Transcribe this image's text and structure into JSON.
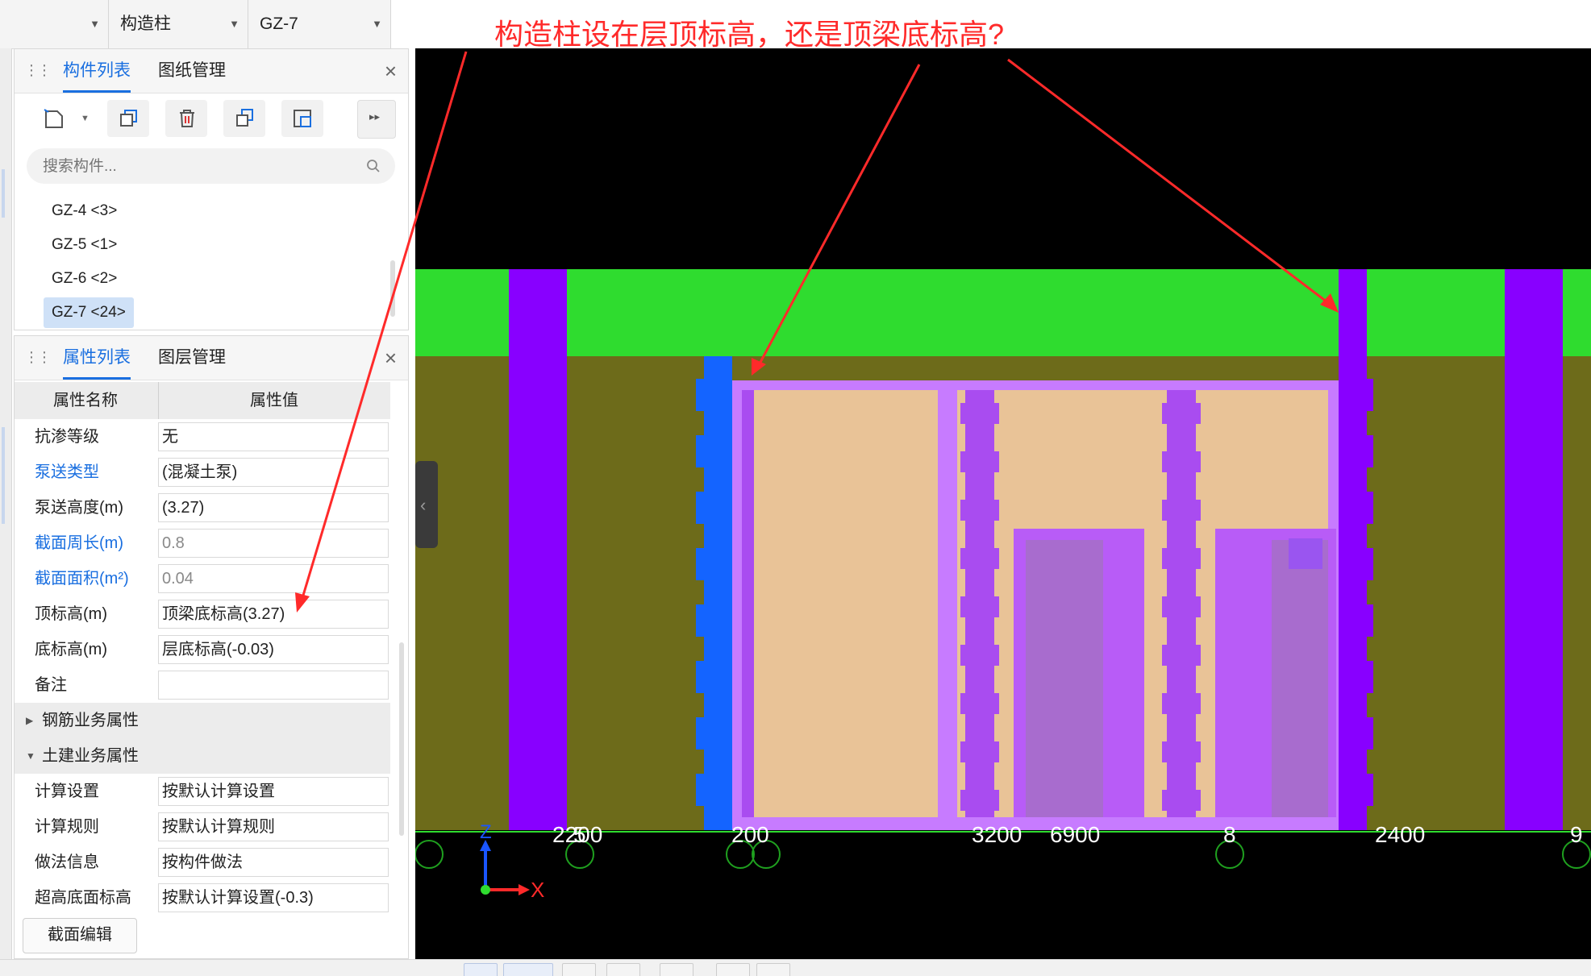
{
  "topbar": {
    "combos": [
      {
        "value": ""
      },
      {
        "value": "构造柱"
      },
      {
        "value": "GZ-7"
      }
    ]
  },
  "annotation": "构造柱设在层顶标高，还是顶梁底标高?",
  "component_panel": {
    "tabs": [
      "构件列表",
      "图纸管理"
    ],
    "active_tab": "构件列表",
    "search": {
      "placeholder": "搜索构件..."
    },
    "items": [
      {
        "label": "GZ-4 <3>",
        "selected": false
      },
      {
        "label": "GZ-5 <1>",
        "selected": false
      },
      {
        "label": "GZ-6 <2>",
        "selected": false
      },
      {
        "label": "GZ-7 <24>",
        "selected": true
      }
    ],
    "toolbar_icons": [
      "new-icon",
      "copy-icon",
      "delete-icon",
      "duplicate-icon",
      "floor-copy-icon",
      "more-icon"
    ]
  },
  "property_panel": {
    "tabs": [
      "属性列表",
      "图层管理"
    ],
    "active_tab": "属性列表",
    "columns": [
      "属性名称",
      "属性值"
    ],
    "rows": [
      {
        "name": "抗渗等级",
        "value": "无",
        "style": ""
      },
      {
        "name": "泵送类型",
        "value": "(混凝土泵)",
        "style": "blue"
      },
      {
        "name": "泵送高度(m)",
        "value": "(3.27)",
        "style": ""
      },
      {
        "name": "截面周长(m)",
        "value": "0.8",
        "style": "blue grey"
      },
      {
        "name": "截面面积(m²)",
        "value": "0.04",
        "style": "blue grey"
      },
      {
        "name": "顶标高(m)",
        "value": "顶梁底标高(3.27)",
        "style": ""
      },
      {
        "name": "底标高(m)",
        "value": "层底标高(-0.03)",
        "style": ""
      },
      {
        "name": "备注",
        "value": "",
        "style": ""
      }
    ],
    "groups": [
      {
        "label": "钢筋业务属性",
        "expanded": false
      },
      {
        "label": "土建业务属性",
        "expanded": true
      }
    ],
    "rows2": [
      {
        "name": "计算设置",
        "value": "按默认计算设置"
      },
      {
        "name": "计算规则",
        "value": "按默认计算规则"
      },
      {
        "name": "做法信息",
        "value": "按构件做法"
      },
      {
        "name": "超高底面标高",
        "value": "按默认计算设置(-0.3)"
      }
    ],
    "section_edit_label": "截面编辑"
  },
  "canvas": {
    "dimensions": [
      "2200",
      "200",
      "3200",
      "6900",
      "2400"
    ],
    "axis_numbers": [
      "5",
      "8",
      "9"
    ],
    "axis_labels": {
      "z": "Z",
      "x": "X"
    },
    "colors": {
      "background": "#000000",
      "beam": "#2fdc2f",
      "wall": "#6d6b1a",
      "column": "#8800ff",
      "blue_column": "#1464ff",
      "window_fill": "#e9c397",
      "frame": "#c77bff",
      "annotation": "#ff2a2a"
    }
  }
}
